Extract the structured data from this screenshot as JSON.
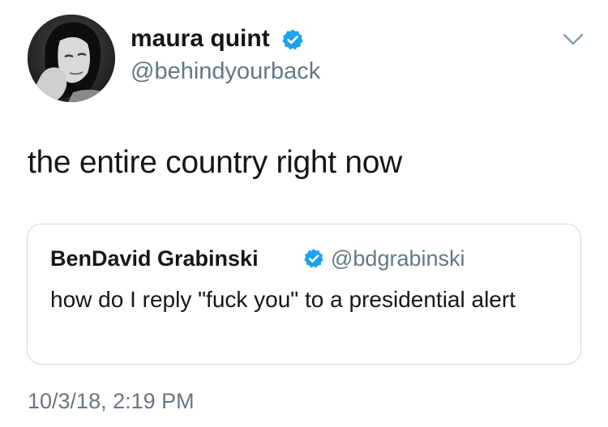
{
  "author": {
    "display_name": "maura quint",
    "handle": "@behindyourback",
    "verified": true
  },
  "tweet": {
    "text": "the entire country right now",
    "timestamp": "10/3/18, 2:19 PM"
  },
  "quoted_tweet": {
    "display_name": "BenDavid Grabinski",
    "handle": "@bdgrabinski",
    "verified": true,
    "text": "how do I reply \"fuck you\" to a presidential alert"
  },
  "icons": {
    "verified": "verified-badge-icon",
    "menu": "chevron-down-icon"
  },
  "colors": {
    "verified_blue": "#1da1f2",
    "secondary_text": "#657786",
    "primary_text": "#14171a",
    "border": "#cfd9de"
  }
}
